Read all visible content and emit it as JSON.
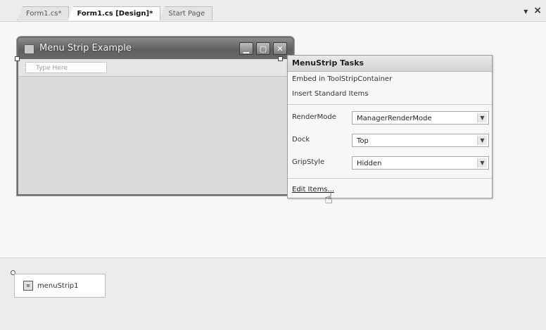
{
  "tabs": [
    {
      "label": "Form1.cs*"
    },
    {
      "label": "Form1.cs [Design]*"
    },
    {
      "label": "Start Page"
    }
  ],
  "tab_controls": {
    "dropdown": "▾",
    "close": "×"
  },
  "form": {
    "title": "Menu Strip Example",
    "menu_placeholder": "Type Here",
    "buttons": {
      "minimize": "▁",
      "maximize": "▢",
      "close": "✕"
    }
  },
  "tasks_panel": {
    "title": "MenuStrip Tasks",
    "links": [
      "Embed in ToolStripContainer",
      "Insert Standard Items"
    ],
    "properties": [
      {
        "label": "RenderMode",
        "value": "ManagerRenderMode"
      },
      {
        "label": "Dock",
        "value": "Top"
      },
      {
        "label": "GripStyle",
        "value": "Hidden"
      }
    ],
    "edit_link": "Edit Items..."
  },
  "tray": {
    "component_label": "menuStrip1"
  },
  "icons": {
    "combo_arrow": "chevron-down-icon",
    "cursor": "hand-pointer-icon"
  }
}
